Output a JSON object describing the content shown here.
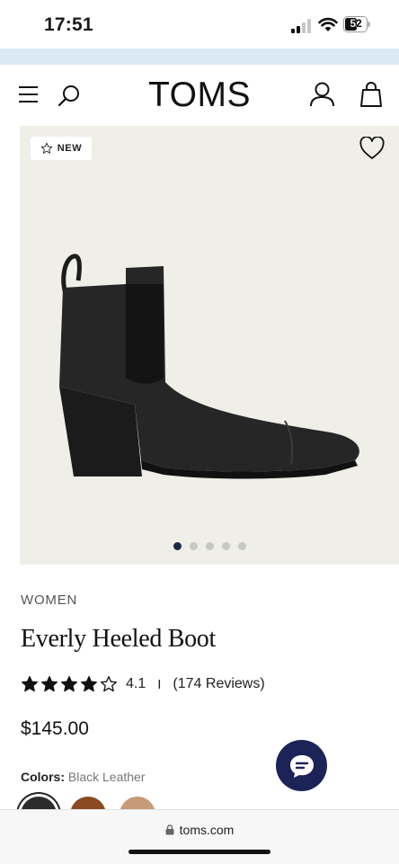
{
  "status_bar": {
    "time": "17:51",
    "battery": "52"
  },
  "header": {
    "logo": "TOMS"
  },
  "product": {
    "badge": "NEW",
    "category": "WOMEN",
    "name": "Everly Heeled Boot",
    "rating": 4.1,
    "rating_label": "4.1",
    "separator": "I",
    "reviews": "(174 Reviews)",
    "price": "$145.00",
    "colors_label": "Colors:",
    "color_selected": "Black Leather",
    "image_count": 5,
    "image_index": 1,
    "swatches": [
      "#2c2c2c",
      "#8b4a22",
      "#c79a78"
    ]
  },
  "browser": {
    "url": "toms.com"
  },
  "colors": {
    "accent": "#1c2357",
    "promo": "#dbe9f5",
    "gallery_bg": "#efeee7"
  }
}
